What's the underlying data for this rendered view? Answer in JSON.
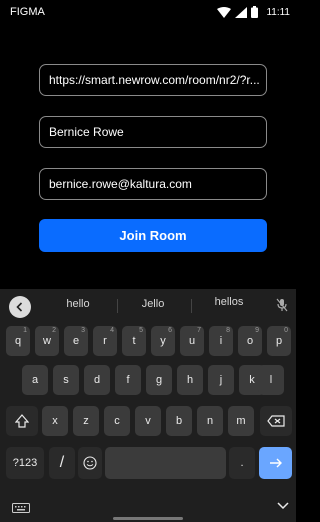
{
  "status_bar": {
    "app_name": "FIGMA",
    "time": "11:11"
  },
  "form": {
    "room_url": "https://smart.newrow.com/room/nr2/?r...",
    "name": "Bernice Rowe",
    "email": "bernice.rowe@kaltura.com",
    "join_label": "Join Room"
  },
  "keyboard": {
    "suggestions": [
      "hello",
      "Jello",
      "hellos"
    ],
    "row1": [
      {
        "label": "q",
        "hint": "1"
      },
      {
        "label": "w",
        "hint": "2"
      },
      {
        "label": "e",
        "hint": "3"
      },
      {
        "label": "r",
        "hint": "4"
      },
      {
        "label": "t",
        "hint": "5"
      },
      {
        "label": "y",
        "hint": "6"
      },
      {
        "label": "u",
        "hint": "7"
      },
      {
        "label": "i",
        "hint": "8"
      },
      {
        "label": "o",
        "hint": "9"
      },
      {
        "label": "p",
        "hint": "0"
      }
    ],
    "row2": [
      "a",
      "s",
      "d",
      "f",
      "g",
      "h",
      "j",
      "k",
      "l"
    ],
    "row3": [
      "x",
      "z",
      "c",
      "v",
      "b",
      "n",
      "m"
    ],
    "symbols_label": "?123",
    "slash_label": "/",
    "period_label": "."
  }
}
